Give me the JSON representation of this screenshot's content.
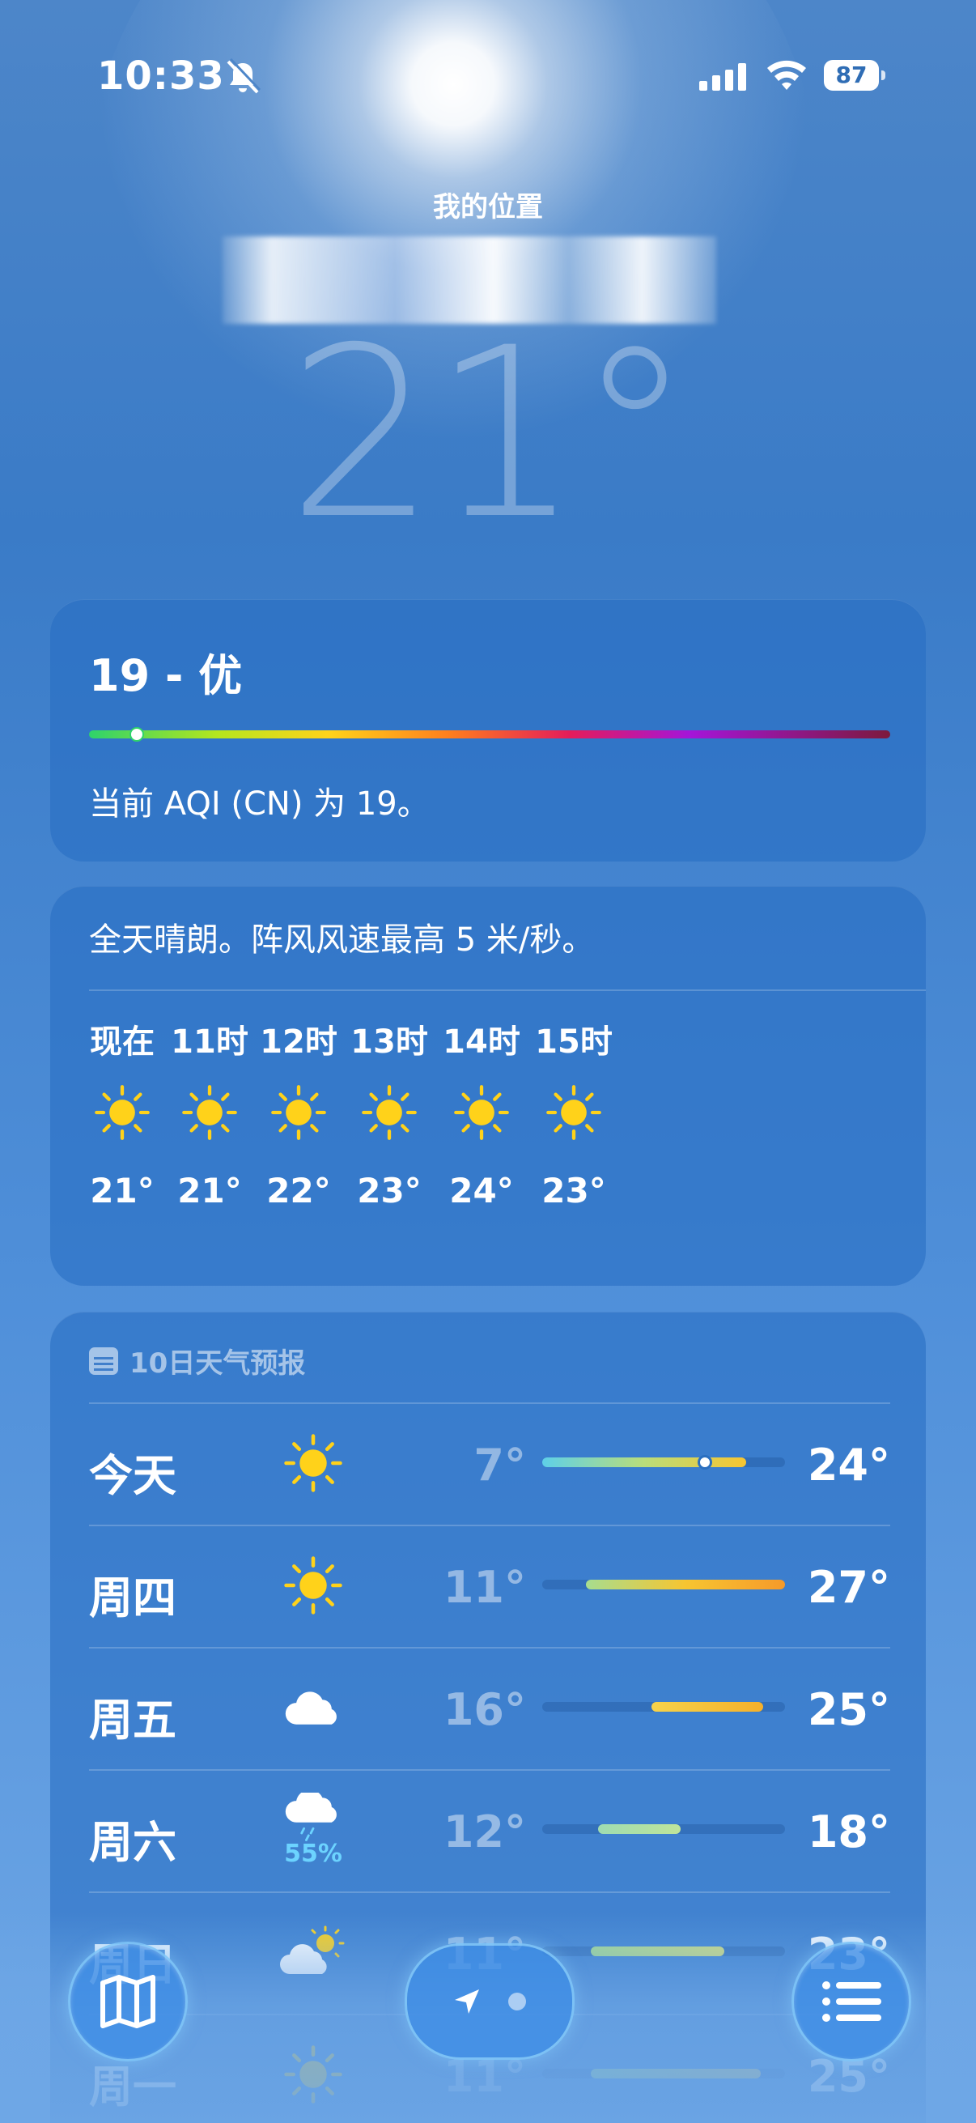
{
  "status_bar": {
    "time": "10:33",
    "battery": "87"
  },
  "location": {
    "label": "我的位置",
    "place": "",
    "temperature": "21°"
  },
  "aqi": {
    "value_label": "19 - 优",
    "description": "当前 AQI (CN) 为 19。",
    "index": 19
  },
  "hourly": {
    "summary": "全天晴朗。阵风风速最高 5 米/秒。",
    "items": [
      {
        "label": "现在",
        "icon": "sun-icon",
        "temp": "21°"
      },
      {
        "label": "11时",
        "icon": "sun-icon",
        "temp": "21°"
      },
      {
        "label": "12时",
        "icon": "sun-icon",
        "temp": "22°"
      },
      {
        "label": "13时",
        "icon": "sun-icon",
        "temp": "23°"
      },
      {
        "label": "14时",
        "icon": "sun-icon",
        "temp": "24°"
      },
      {
        "label": "15时",
        "icon": "sun-icon",
        "temp": "23°"
      }
    ]
  },
  "forecast": {
    "title": "10日天气预报",
    "days": [
      {
        "day": "今天",
        "icon": "sun-icon",
        "low": "7°",
        "high": "24°",
        "precip": "",
        "range_start": 0.0,
        "range_end": 0.84,
        "current": 0.67,
        "colors": [
          "#5ed0e8",
          "#b9dd7a",
          "#f7c531"
        ]
      },
      {
        "day": "周四",
        "icon": "sun-icon",
        "low": "11°",
        "high": "27°",
        "precip": "",
        "range_start": 0.18,
        "range_end": 1.0,
        "colors": [
          "#a7dd8f",
          "#f7c531",
          "#f59a2a"
        ]
      },
      {
        "day": "周五",
        "icon": "cloud-icon",
        "low": "16°",
        "high": "25°",
        "precip": "",
        "range_start": 0.45,
        "range_end": 0.91,
        "colors": [
          "#f7d34a",
          "#f5b02a"
        ]
      },
      {
        "day": "周六",
        "icon": "cloud-rain-icon",
        "low": "12°",
        "high": "18°",
        "precip": "55%",
        "range_start": 0.23,
        "range_end": 0.57,
        "colors": [
          "#9fdcb1",
          "#bfe59a"
        ]
      },
      {
        "day": "周日",
        "icon": "partly-sunny-icon",
        "low": "11°",
        "high": "23°",
        "precip": "",
        "range_start": 0.2,
        "range_end": 0.75,
        "colors": [
          "#a7dd8f",
          "#d7e07a"
        ]
      },
      {
        "day": "周一",
        "icon": "sun-icon",
        "low": "11°",
        "high": "25°",
        "precip": "",
        "range_start": 0.2,
        "range_end": 0.9,
        "colors": [
          "#a7dd8f",
          "#e8cf6a"
        ]
      }
    ]
  },
  "toolbar": {
    "map": "map-icon",
    "location": "location-arrow-icon",
    "list": "list-icon"
  },
  "colors": {
    "sun": "#ffd21a",
    "accent_blue": "#3a7bc7",
    "precip": "#6cd3ff"
  }
}
